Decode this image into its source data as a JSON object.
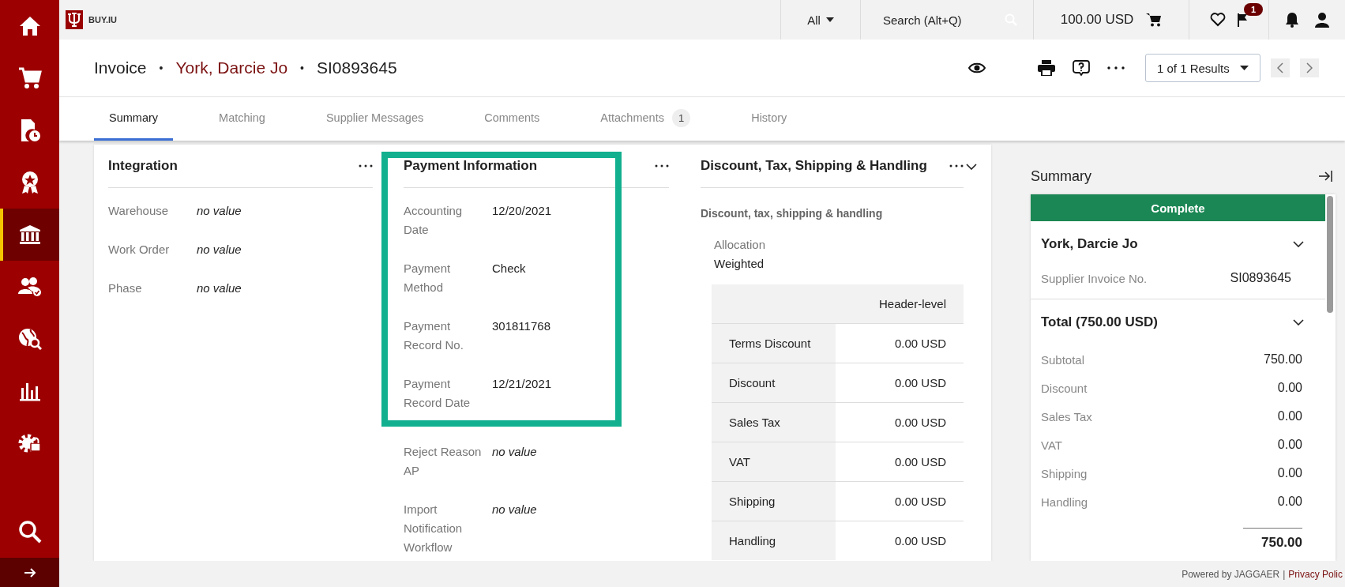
{
  "sidebar": {
    "items": [
      {
        "kind": "home",
        "selected": false
      },
      {
        "kind": "cart",
        "selected": false
      },
      {
        "kind": "document-clock",
        "selected": false
      },
      {
        "kind": "award",
        "selected": false
      },
      {
        "kind": "bank",
        "selected": true
      },
      {
        "kind": "people",
        "selected": false
      },
      {
        "kind": "globe",
        "selected": false
      },
      {
        "kind": "chart",
        "selected": false
      },
      {
        "kind": "gear-lock",
        "selected": false
      }
    ]
  },
  "top_bar": {
    "brand": "BUY.IU",
    "scope": "All",
    "search": {
      "placeholder": "Search (Alt+Q)"
    },
    "cart_total": "100.00 USD",
    "flag_badge": "1"
  },
  "header": {
    "title_parts": [
      "Invoice",
      "York, Darcie Jo",
      "SI0893645"
    ],
    "separator": "•",
    "results": "1 of 1 Results"
  },
  "tabs": [
    {
      "label": "Summary",
      "selected": true
    },
    {
      "label": "Matching",
      "selected": false
    },
    {
      "label": "Supplier Messages",
      "selected": false
    },
    {
      "label": "Comments",
      "selected": false
    },
    {
      "label": "Attachments",
      "selected": false,
      "badge": "1"
    },
    {
      "label": "History",
      "selected": false
    }
  ],
  "integration": {
    "title": "Integration",
    "fields": [
      {
        "label": "Warehouse",
        "value": "no value",
        "empty": true
      },
      {
        "label": "Work Order",
        "value": "no value",
        "empty": true
      },
      {
        "label": "Phase",
        "value": "no value",
        "empty": true
      }
    ]
  },
  "payment_information": {
    "title": "Payment Information",
    "highlighted_fields": [
      {
        "label": "Accounting Date",
        "value": "12/20/2021",
        "empty": false
      },
      {
        "label": "Payment Method",
        "value": "Check",
        "empty": false
      },
      {
        "label": "Payment Record No.",
        "value": "301811768",
        "empty": false
      },
      {
        "label": "Payment Record Date",
        "value": "12/21/2021",
        "empty": false
      }
    ],
    "fields": [
      {
        "label": "Reject Reason AP",
        "value": "no value",
        "empty": true
      },
      {
        "label": "Import Notification Workflow",
        "value": "no value",
        "empty": true
      }
    ]
  },
  "discount": {
    "title": "Discount, Tax, Shipping & Handling",
    "subtitle": "Discount, tax, shipping & handling",
    "allocation_label": "Allocation",
    "allocation_value": "Weighted",
    "table": {
      "columns": [
        "Header-level"
      ],
      "rows": [
        {
          "label": "Terms Discount",
          "value": "0.00 USD"
        },
        {
          "label": "Discount",
          "value": "0.00 USD"
        },
        {
          "label": "Sales Tax",
          "value": "0.00 USD"
        },
        {
          "label": "VAT",
          "value": "0.00 USD"
        },
        {
          "label": "Shipping",
          "value": "0.00 USD"
        },
        {
          "label": "Handling",
          "value": "0.00 USD"
        }
      ]
    }
  },
  "summary": {
    "title": "Summary",
    "status": "Complete",
    "supplier": {
      "name": "York, Darcie Jo",
      "fields": [
        {
          "label": "Supplier Invoice No.",
          "value": "SI0893645"
        }
      ]
    },
    "total": {
      "title": "Total (750.00 USD)",
      "lines": [
        {
          "label": "Subtotal",
          "value": "750.00"
        },
        {
          "label": "Discount",
          "value": "0.00"
        },
        {
          "label": "Sales Tax",
          "value": "0.00"
        },
        {
          "label": "VAT",
          "value": "0.00"
        },
        {
          "label": "Shipping",
          "value": "0.00"
        },
        {
          "label": "Handling",
          "value": "0.00"
        }
      ],
      "grand_total": "750.00"
    }
  },
  "footer": {
    "powered_by": "Powered by JAGGAER",
    "separator": "|",
    "privacy_link": "Privacy Polic"
  }
}
